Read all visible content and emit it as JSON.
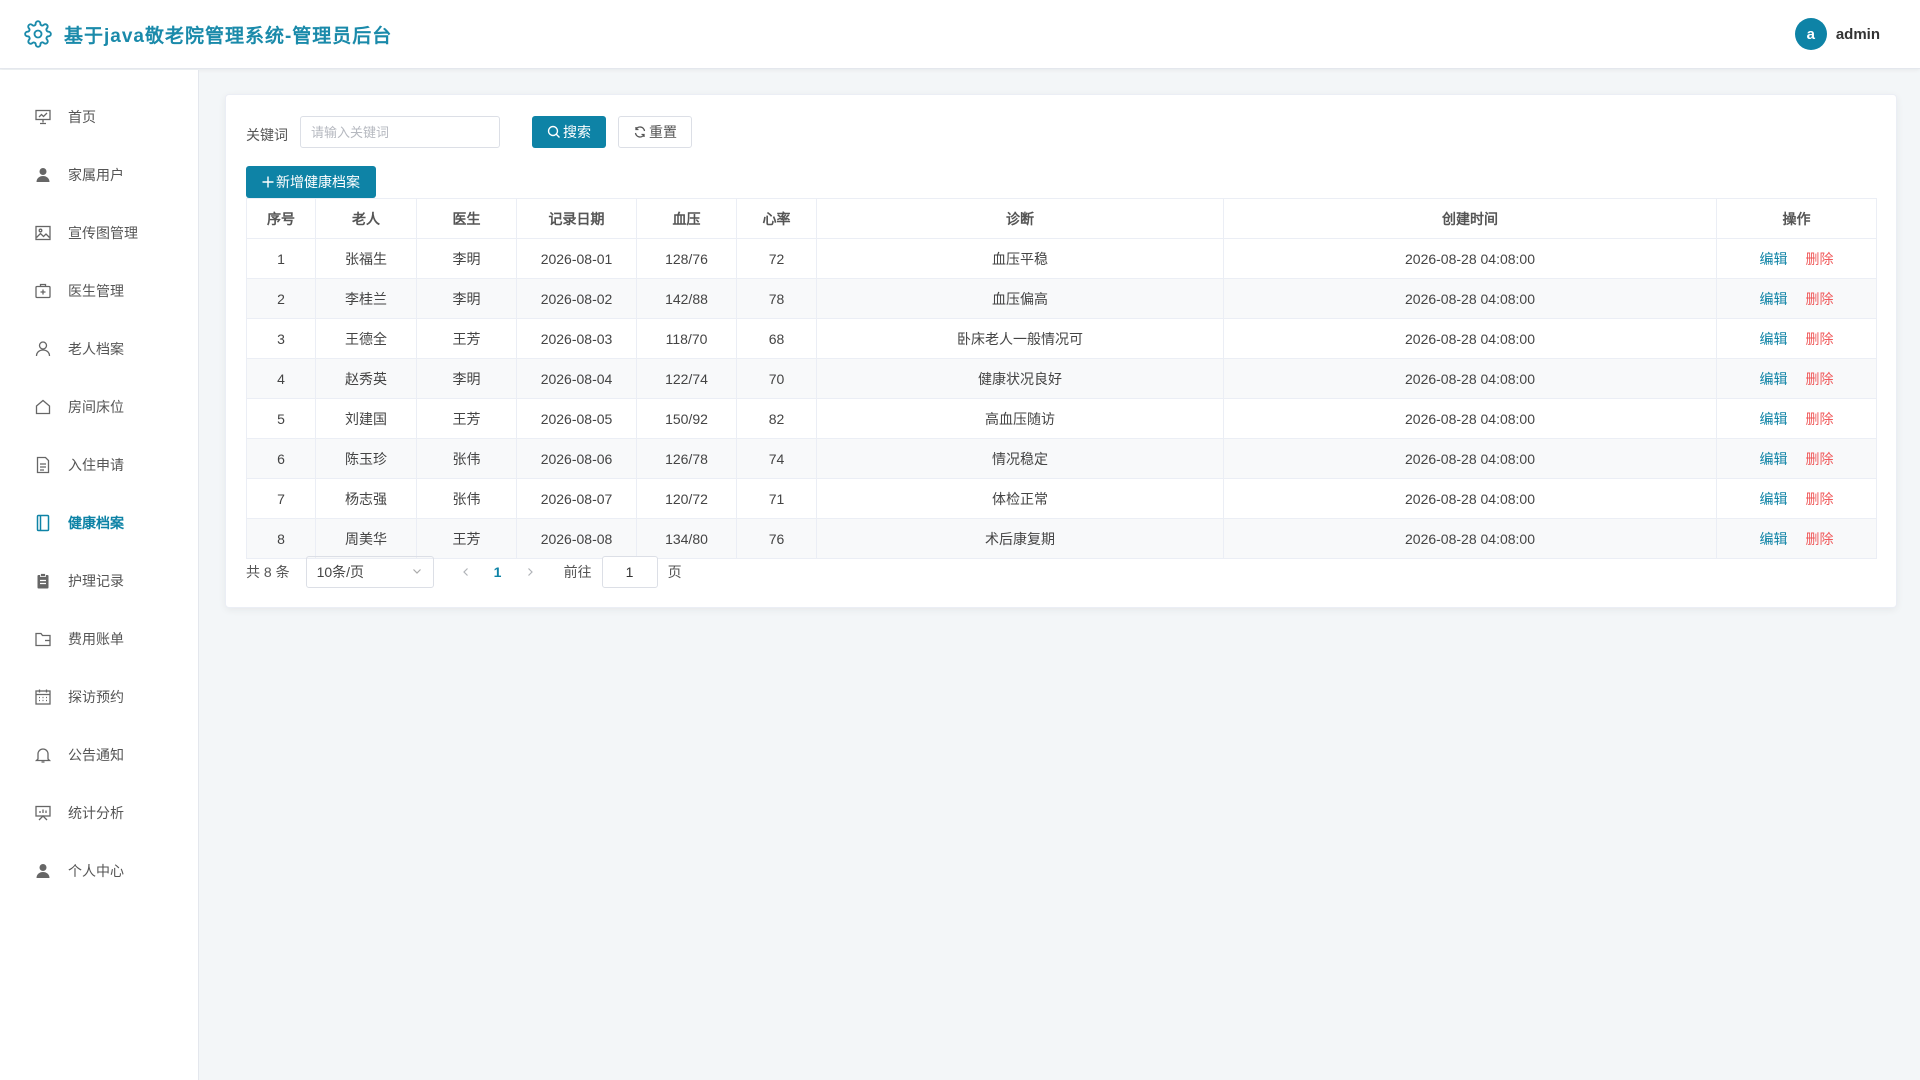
{
  "header": {
    "title": "基于java敬老院管理系统-管理员后台",
    "avatar_letter": "a",
    "username": "admin",
    "settings_icon": "gear-icon"
  },
  "colors": {
    "accent": "#0e83a6",
    "danger": "#f0595a",
    "title": "#1a8aaa"
  },
  "sidebar": {
    "active": "健康档案",
    "items": [
      {
        "label": "首页",
        "icon": "presentation-icon"
      },
      {
        "label": "家属用户",
        "icon": "user-solid-icon"
      },
      {
        "label": "宣传图管理",
        "icon": "picture-icon"
      },
      {
        "label": "医生管理",
        "icon": "first-aid-icon"
      },
      {
        "label": "老人档案",
        "icon": "user-outline-icon"
      },
      {
        "label": "房间床位",
        "icon": "house-icon"
      },
      {
        "label": "入住申请",
        "icon": "document-icon"
      },
      {
        "label": "健康档案",
        "icon": "notebook-icon"
      },
      {
        "label": "护理记录",
        "icon": "clipboard-icon"
      },
      {
        "label": "费用账单",
        "icon": "wallet-folder-icon"
      },
      {
        "label": "探访预约",
        "icon": "calendar-icon"
      },
      {
        "label": "公告通知",
        "icon": "bell-icon"
      },
      {
        "label": "统计分析",
        "icon": "data-board-icon"
      },
      {
        "label": "个人中心",
        "icon": "user-solid-icon"
      }
    ]
  },
  "search": {
    "label": "关键词",
    "placeholder": "请输入关键词",
    "value": "",
    "search_label": "搜索",
    "reset_label": "重置",
    "add_label": "新增健康档案"
  },
  "table": {
    "columns": [
      "序号",
      "老人",
      "医生",
      "记录日期",
      "血压",
      "心率",
      "诊断",
      "创建时间",
      "操作"
    ],
    "edit_label": "编辑",
    "delete_label": "删除",
    "rows": [
      [
        "1",
        "张福生",
        "李明",
        "2026-08-01",
        "128/76",
        "72",
        "血压平稳",
        "2026-08-28 04:08:00"
      ],
      [
        "2",
        "李桂兰",
        "李明",
        "2026-08-02",
        "142/88",
        "78",
        "血压偏高",
        "2026-08-28 04:08:00"
      ],
      [
        "3",
        "王德全",
        "王芳",
        "2026-08-03",
        "118/70",
        "68",
        "卧床老人一般情况可",
        "2026-08-28 04:08:00"
      ],
      [
        "4",
        "赵秀英",
        "李明",
        "2026-08-04",
        "122/74",
        "70",
        "健康状况良好",
        "2026-08-28 04:08:00"
      ],
      [
        "5",
        "刘建国",
        "王芳",
        "2026-08-05",
        "150/92",
        "82",
        "高血压随访",
        "2026-08-28 04:08:00"
      ],
      [
        "6",
        "陈玉珍",
        "张伟",
        "2026-08-06",
        "126/78",
        "74",
        "情况稳定",
        "2026-08-28 04:08:00"
      ],
      [
        "7",
        "杨志强",
        "张伟",
        "2026-08-07",
        "120/72",
        "71",
        "体检正常",
        "2026-08-28 04:08:00"
      ],
      [
        "8",
        "周美华",
        "王芳",
        "2026-08-08",
        "134/80",
        "76",
        "术后康复期",
        "2026-08-28 04:08:00"
      ]
    ]
  },
  "pagination": {
    "total_text": "共 8 条",
    "page_size": "10条/页",
    "current_page": "1",
    "goto_label": "前往",
    "goto_value": "1",
    "page_suffix": "页"
  }
}
